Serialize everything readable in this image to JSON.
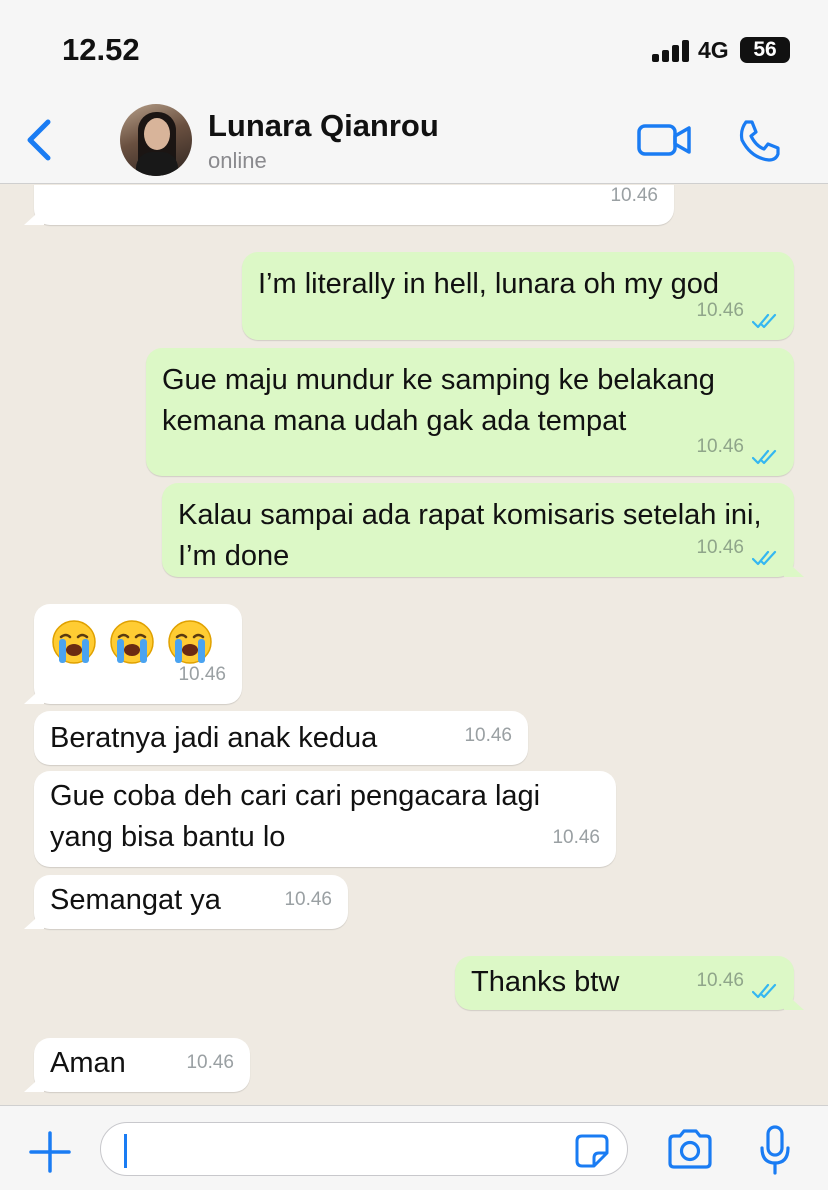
{
  "status_bar": {
    "time": "12.52",
    "network": "4G",
    "battery": "56"
  },
  "header": {
    "contact_name": "Lunara Qianrou",
    "contact_status": "online",
    "accent_color": "#1a7cf3",
    "icons": {
      "back": "chevron-left-icon",
      "video": "video-camera-icon",
      "call": "phone-icon"
    }
  },
  "messages": [
    {
      "direction": "in",
      "text": "",
      "time": "10.46"
    },
    {
      "direction": "out",
      "text": "I’m literally in hell, lunara oh my god",
      "time": "10.46",
      "read": true
    },
    {
      "direction": "out",
      "text": "Gue maju mundur ke samping ke belakang kemana mana udah gak ada tempat",
      "time": "10.46",
      "read": true
    },
    {
      "direction": "out",
      "text": "Kalau sampai ada rapat komisaris setelah ini, I’m done",
      "time": "10.46",
      "read": true
    },
    {
      "direction": "in",
      "emoji": [
        "loudly-crying-face",
        "loudly-crying-face",
        "loudly-crying-face"
      ],
      "time": "10.46"
    },
    {
      "direction": "in",
      "text": "Beratnya jadi anak kedua",
      "time": "10.46"
    },
    {
      "direction": "in",
      "text": "Gue coba deh cari cari pengacara lagi yang bisa bantu lo",
      "time": "10.46"
    },
    {
      "direction": "in",
      "text": "Semangat ya",
      "time": "10.46"
    },
    {
      "direction": "out",
      "text": "Thanks btw",
      "time": "10.46",
      "read": true
    },
    {
      "direction": "in",
      "text": "Aman",
      "time": "10.46"
    }
  ],
  "input_bar": {
    "value": "",
    "icons": {
      "attach": "plus-icon",
      "sticker": "sticker-icon",
      "camera": "camera-icon",
      "mic": "microphone-icon"
    }
  }
}
